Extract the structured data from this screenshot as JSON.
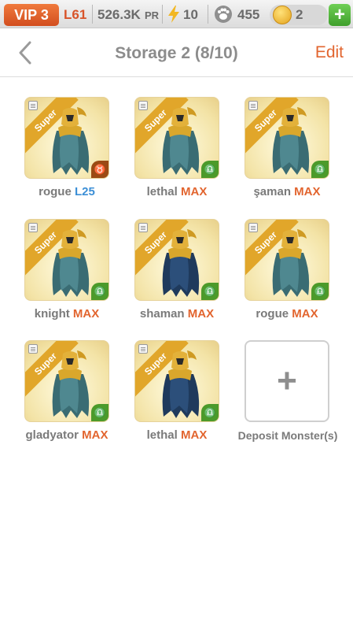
{
  "status_bar": {
    "vip": "VIP 3",
    "level": "L61",
    "power": "526.3K",
    "power_unit": "PR",
    "energy": "10",
    "food": "455",
    "gold": "2",
    "plus": "+"
  },
  "nav": {
    "title": "Storage 2 (8/10)",
    "edit": "Edit"
  },
  "monsters": [
    {
      "name": "rogue",
      "level": "L25",
      "badge": "Super",
      "sign": "♉",
      "sign_color": "brown",
      "variant": "teal"
    },
    {
      "name": "lethal",
      "level": "MAX",
      "badge": "Super",
      "sign": "♎",
      "sign_color": "green",
      "variant": "teal"
    },
    {
      "name": "şaman",
      "level": "MAX",
      "badge": "Super",
      "sign": "♎",
      "sign_color": "green",
      "variant": "teal"
    },
    {
      "name": "knight",
      "level": "MAX",
      "badge": "Super",
      "sign": "♎",
      "sign_color": "green",
      "variant": "teal"
    },
    {
      "name": "shaman",
      "level": "MAX",
      "badge": "Super",
      "sign": "♎",
      "sign_color": "green",
      "variant": "navy"
    },
    {
      "name": "rogue",
      "level": "MAX",
      "badge": "Super",
      "sign": "♎",
      "sign_color": "green",
      "variant": "teal"
    },
    {
      "name": "gladyator",
      "level": "MAX",
      "badge": "Super",
      "sign": "♎",
      "sign_color": "green",
      "variant": "teal"
    },
    {
      "name": "lethal",
      "level": "MAX",
      "badge": "Super",
      "sign": "♎",
      "sign_color": "green",
      "variant": "navy"
    }
  ],
  "deposit": {
    "plus": "+",
    "label": "Deposit Monster(s)"
  },
  "colors": {
    "accent": "#e2652f",
    "level_blue": "#3c8fd6",
    "text_gray": "#7a7a7a"
  }
}
